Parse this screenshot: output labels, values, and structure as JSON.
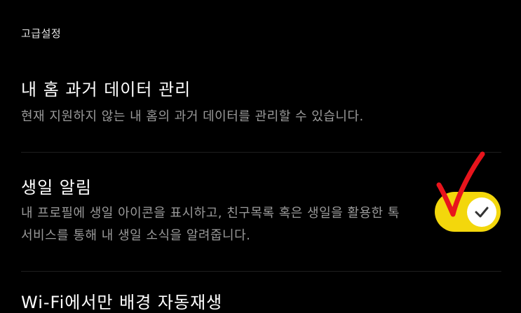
{
  "section": {
    "title": "고급설정"
  },
  "settings": [
    {
      "title": "내 홈 과거 데이터 관리",
      "description": "현재 지원하지 않는 내 홈의 과거 데이터를 관리할 수 있습니다."
    },
    {
      "title": "생일 알림",
      "description": "내 프로필에 생일 아이콘을 표시하고, 친구목록 혹은 생일을 활용한 톡 서비스를 통해 내 생일 소식을 알려줍니다.",
      "toggle": {
        "state": "on",
        "icon": "checkmark-icon",
        "color": "#f3d70c"
      }
    },
    {
      "title": "Wi-Fi에서만 배경 자동재생"
    }
  ],
  "annotation": {
    "icon": "red-check-mark",
    "color": "#e8141c"
  }
}
